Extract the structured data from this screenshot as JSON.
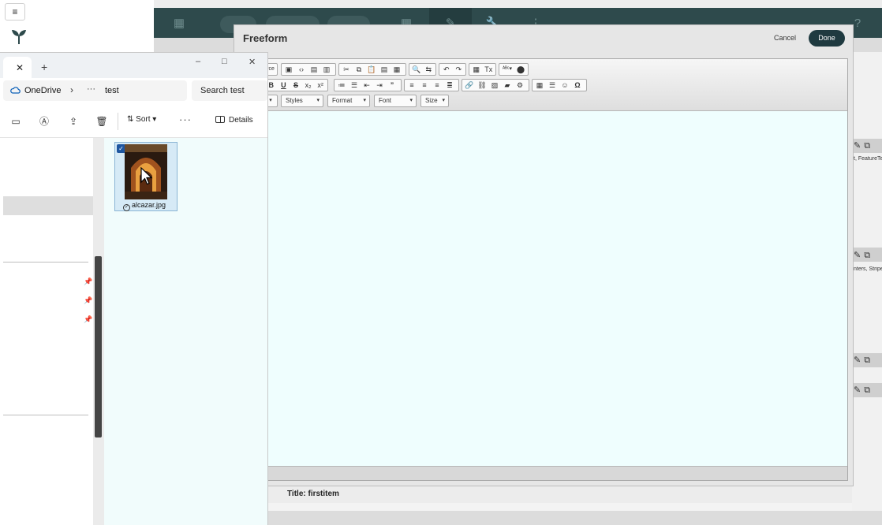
{
  "background_app": {
    "menu_icon": "hamburger-icon",
    "logo": "plant-logo-icon",
    "header_icons": [
      "grid-icon",
      "edit-icon",
      "wrench-icon",
      "kebab-icon"
    ],
    "right_panel": {
      "row1_text": "t, FeatureTe",
      "row2_text": "nters, Stripe",
      "icons": [
        "edit-icon",
        "copy-icon"
      ]
    },
    "title_row": "Title: firstitem",
    "colors": {
      "header": "#2e4a4c",
      "accent": "#1f3a40"
    }
  },
  "dialog": {
    "title": "Freeform",
    "cancel_label": "Cancel",
    "done_label": "Done",
    "toolbar": {
      "source_fragment": "rce",
      "bold": "B",
      "underline": "U",
      "strike": "S",
      "subscript": "x₂",
      "superscript": "x²",
      "blockquote": "”",
      "omega": "Ω",
      "styles_label": "Styles",
      "format_label": "Format",
      "font_label": "Font",
      "size_label": "Size"
    },
    "content_bg": "#effefe"
  },
  "explorer": {
    "tab_close": "✕",
    "new_tab": "+",
    "window_controls": [
      "–",
      "□",
      "✕"
    ],
    "breadcrumb": {
      "root": "OneDrive",
      "separator": "›",
      "overflow": "···",
      "folder": "test"
    },
    "search_placeholder": "Search test",
    "commands": {
      "sort_label": "Sort",
      "more_label": "···",
      "details_label": "Details"
    },
    "file": {
      "name": "alcazar.jpg",
      "selected": true
    }
  }
}
